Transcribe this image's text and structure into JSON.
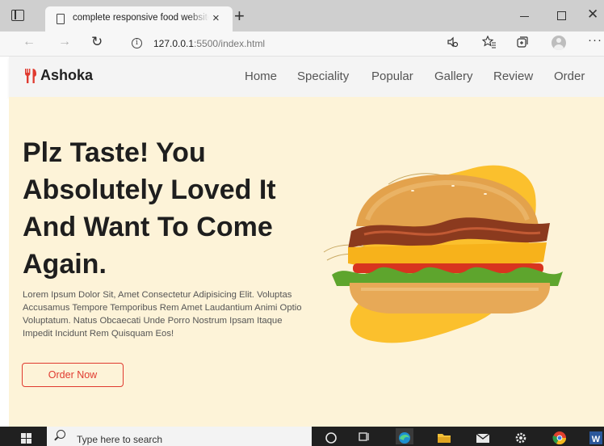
{
  "browser": {
    "tab_title": "complete responsive food website",
    "url_host": "127.0.0.1",
    "url_rest": ":5500/index.html",
    "new_tab_glyph": "+",
    "close_tab_glyph": "×"
  },
  "site": {
    "brand": "Ashoka",
    "brand_color": "#e03a2f",
    "nav": [
      "Home",
      "Speciality",
      "Popular",
      "Gallery",
      "Review",
      "Order"
    ]
  },
  "hero": {
    "title": "Plz Taste! You Absolutely Loved It And Want To Come Again.",
    "text": "Lorem Ipsum Dolor Sit, Amet Consectetur Adipisicing Elit. Voluptas Accusamus Tempore Temporibus Rem Amet Laudantium Animi Optio Voluptatum. Natus Obcaecati Unde Porro Nostrum Ipsam Itaque Impedit Incidunt Rem Quisquam Eos!",
    "button": "Order Now",
    "background": "#fdf3d8",
    "blob_color": "#fbc02d"
  },
  "taskbar": {
    "search_placeholder": "Type here to search"
  },
  "icons": [
    "tab-actions-icon",
    "page-icon",
    "back-icon",
    "forward-icon",
    "reload-icon",
    "info-icon",
    "read-aloud-icon",
    "favorites-icon",
    "collections-icon",
    "profile-icon",
    "more-icon",
    "fork-knife-icon",
    "windows-start-icon",
    "search-icon",
    "cortana-icon",
    "task-view-icon",
    "edge-icon",
    "file-explorer-icon",
    "mail-icon",
    "settings-icon",
    "chrome-icon",
    "word-icon"
  ]
}
